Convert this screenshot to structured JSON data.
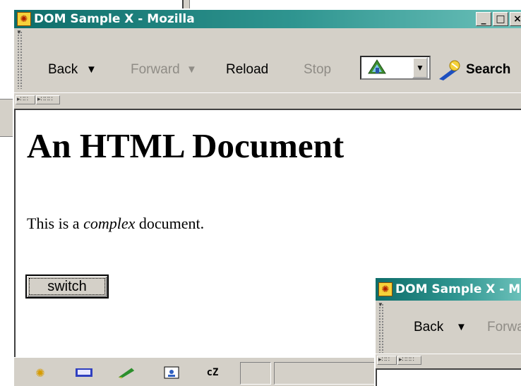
{
  "window": {
    "title": "DOM Sample X - Mozilla",
    "controls": {
      "minimize": "_",
      "maximize": "□",
      "close": "×"
    }
  },
  "toolbar": {
    "back_label": "Back",
    "forward_label": "Forward",
    "reload_label": "Reload",
    "stop_label": "Stop",
    "dropdown_glyph": "▼",
    "search_label": "Search"
  },
  "document": {
    "heading": "An HTML Document",
    "para_before": "This is a ",
    "para_emphasis": "complex",
    "para_after": " document.",
    "button_label": "switch"
  },
  "second_window": {
    "title": "DOM Sample X - Mozilla",
    "back_label": "Back",
    "forward_label": "Forward"
  },
  "statusbar": {
    "icons": [
      "mozilla-icon",
      "mail-icon",
      "composer-icon",
      "addressbook-icon",
      "chatzilla-icon"
    ],
    "chatzilla_text": "cZ"
  },
  "colors": {
    "titlebar_start": "#0e6d6a",
    "titlebar_end": "#6cc1ba",
    "chrome": "#d4d0c8",
    "disabled_text": "#8f8c86"
  }
}
